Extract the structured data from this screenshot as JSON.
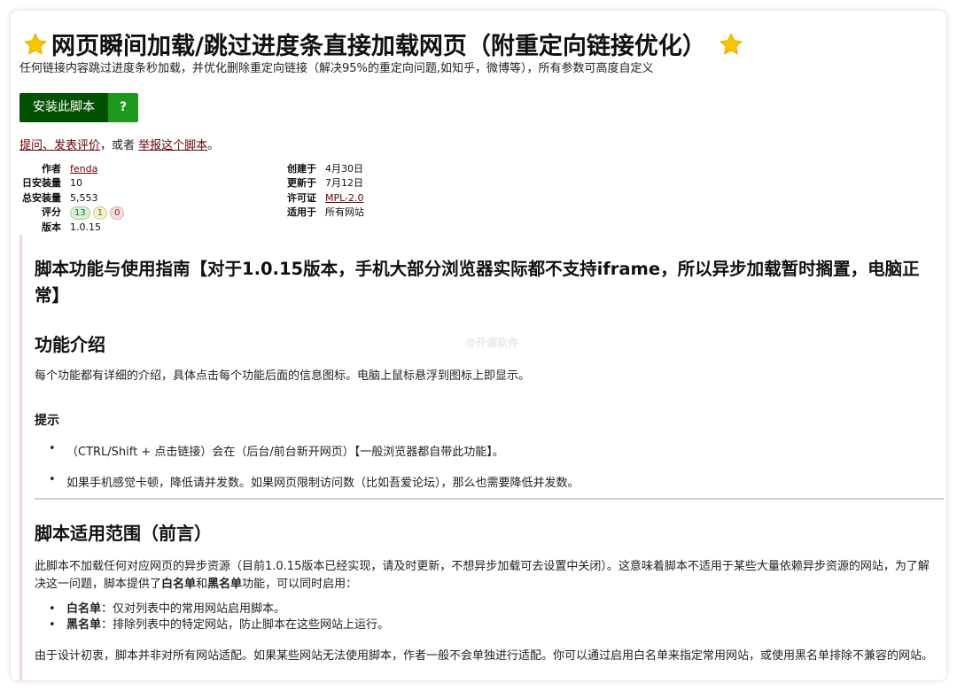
{
  "script": {
    "title": "网页瞬间加载/跳过进度条直接加载网页（附重定向链接优化）",
    "description": "任何链接内容跳过进度条秒加载，并优化删除重定向链接（解决95%的重定向问题,如知乎，微博等），所有参数可高度自定义",
    "install_label": "安装此脚本",
    "install_help_label": "?",
    "feedback": {
      "ask_link": "提问、发表评价",
      "or_text": "，或者 ",
      "report_link": "举报这个脚本",
      "end": "。"
    }
  },
  "meta_left": {
    "author_label": "作者",
    "author_value": "fenda",
    "daily_label": "日安装量",
    "daily_value": "10",
    "total_label": "总安装量",
    "total_value": "5,553",
    "rating_label": "评分",
    "rating_good": "13",
    "rating_ok": "1",
    "rating_bad": "0",
    "version_label": "版本",
    "version_value": "1.0.15"
  },
  "meta_right": {
    "created_label": "创建于",
    "created_value": "4月30日",
    "updated_label": "更新于",
    "updated_value": "7月12日",
    "license_label": "许可证",
    "license_value": "MPL-2.0",
    "applies_label": "适用于",
    "applies_value": "所有网站"
  },
  "article": {
    "guide_heading": "脚本功能与使用指南【对于1.0.15版本，手机大部分浏览器实际都不支持iframe，所以异步加载暂时搁置，电脑正常】",
    "features_heading": "功能介绍",
    "features_text": "每个功能都有详细的介绍，具体点击每个功能后面的信息图标。电脑上鼠标悬浮到图标上即显示。",
    "tips_heading": "提示",
    "tips": [
      "（CTRL/Shift + 点击链接）会在（后台/前台新开网页）【一般浏览器都自带此功能】。",
      "如果手机感觉卡顿，降低请并发数。如果网页限制访问数（比如吾爱论坛），那么也需要降低并发数。"
    ],
    "scope_heading": "脚本适用范围（前言）",
    "scope_text_a": "此脚本不加载任何对应网页的异步资源（目前1.0.15版本已经实现，请及时更新，不想异步加载可去设置中关闭）。这意味着脚本不适用于某些大量依赖异步资源的网站，为了解决这一问题，脚本提供了",
    "scope_whitelist": "白名单",
    "scope_and": "和",
    "scope_blacklist": "黑名单",
    "scope_text_b": "功能，可以同时启用：",
    "list_whitelist_term": "白名单",
    "list_whitelist_desc": "：仅对列表中的常用网站启用脚本。",
    "list_blacklist_term": "黑名单",
    "list_blacklist_desc": "：排除列表中的特定网站，防止脚本在这些网站上运行。",
    "closing_text": "由于设计初衷，脚本并非对所有网站适配。如果某些网站无法使用脚本，作者一般不会单独进行适配。你可以通过启用白名单来指定常用网站，或使用黑名单排除不兼容的网站。",
    "watermark": "@开源软件"
  },
  "colors": {
    "install_main": "#005200",
    "install_help": "#1e971e",
    "link": "#670000",
    "star": "#f7c400",
    "article_border": "#f5d4d4"
  },
  "icons": {
    "title_left": "star-icon",
    "title_right": "star-icon"
  }
}
